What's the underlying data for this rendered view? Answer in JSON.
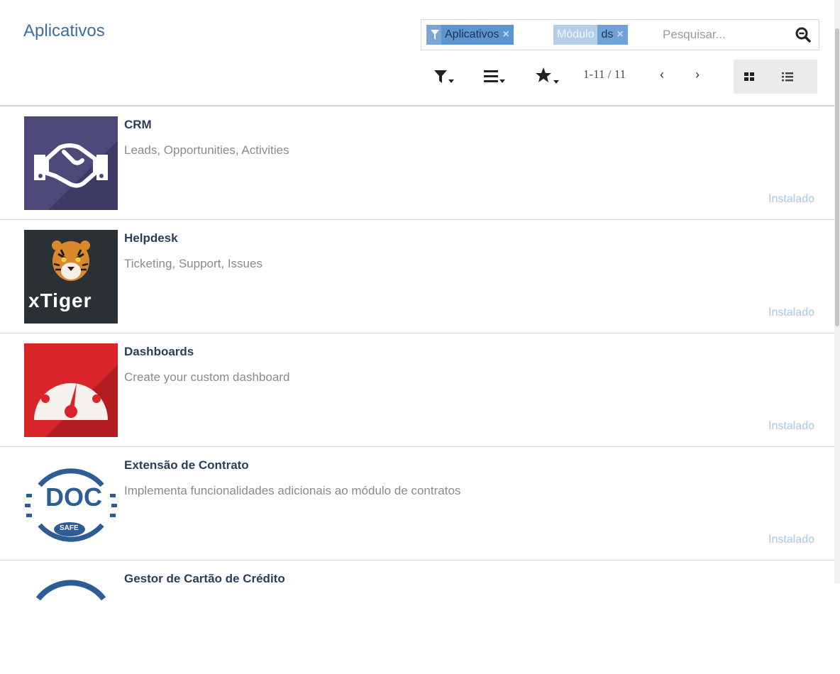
{
  "header": {
    "title": "Aplicativos"
  },
  "search": {
    "facets": [
      {
        "value": "Aplicativos",
        "remove": "×"
      },
      {
        "name": "Módulo",
        "value": "ds",
        "remove": "×"
      }
    ],
    "placeholder": "Pesquisar..."
  },
  "pager": {
    "range": "1-11 / 11",
    "prev": "‹",
    "next": "›"
  },
  "icons": {
    "filter": "filter-icon",
    "group_by": "group-by-icon",
    "favorites": "star-icon",
    "search": "search-icon",
    "kanban": "kanban-view-icon",
    "list": "list-view-icon"
  },
  "colors": {
    "accent": "#3b6ea5",
    "installed": "#a9c6e3",
    "crm_bg": "#4d4a7a",
    "tiger_bg": "#2b3035",
    "dash_bg": "#d9252a",
    "doc_blue": "#2e5c96"
  },
  "apps": [
    {
      "name": "CRM",
      "summary": "Leads, Opportunities, Activities",
      "status": "Instalado"
    },
    {
      "name": "Helpdesk",
      "summary": "Ticketing, Support, Issues",
      "status": "Instalado",
      "logo_text": "xTiger"
    },
    {
      "name": "Dashboards",
      "summary": "Create your custom dashboard",
      "status": "Instalado"
    },
    {
      "name": "Extensão de Contrato",
      "summary": "Implementa funcionalidades adicionais ao módulo de contratos",
      "status": "Instalado",
      "logo_text": "DOC",
      "logo_badge": "SAFE"
    },
    {
      "name": "Gestor de Cartão de Crédito",
      "summary": "",
      "status": ""
    }
  ]
}
